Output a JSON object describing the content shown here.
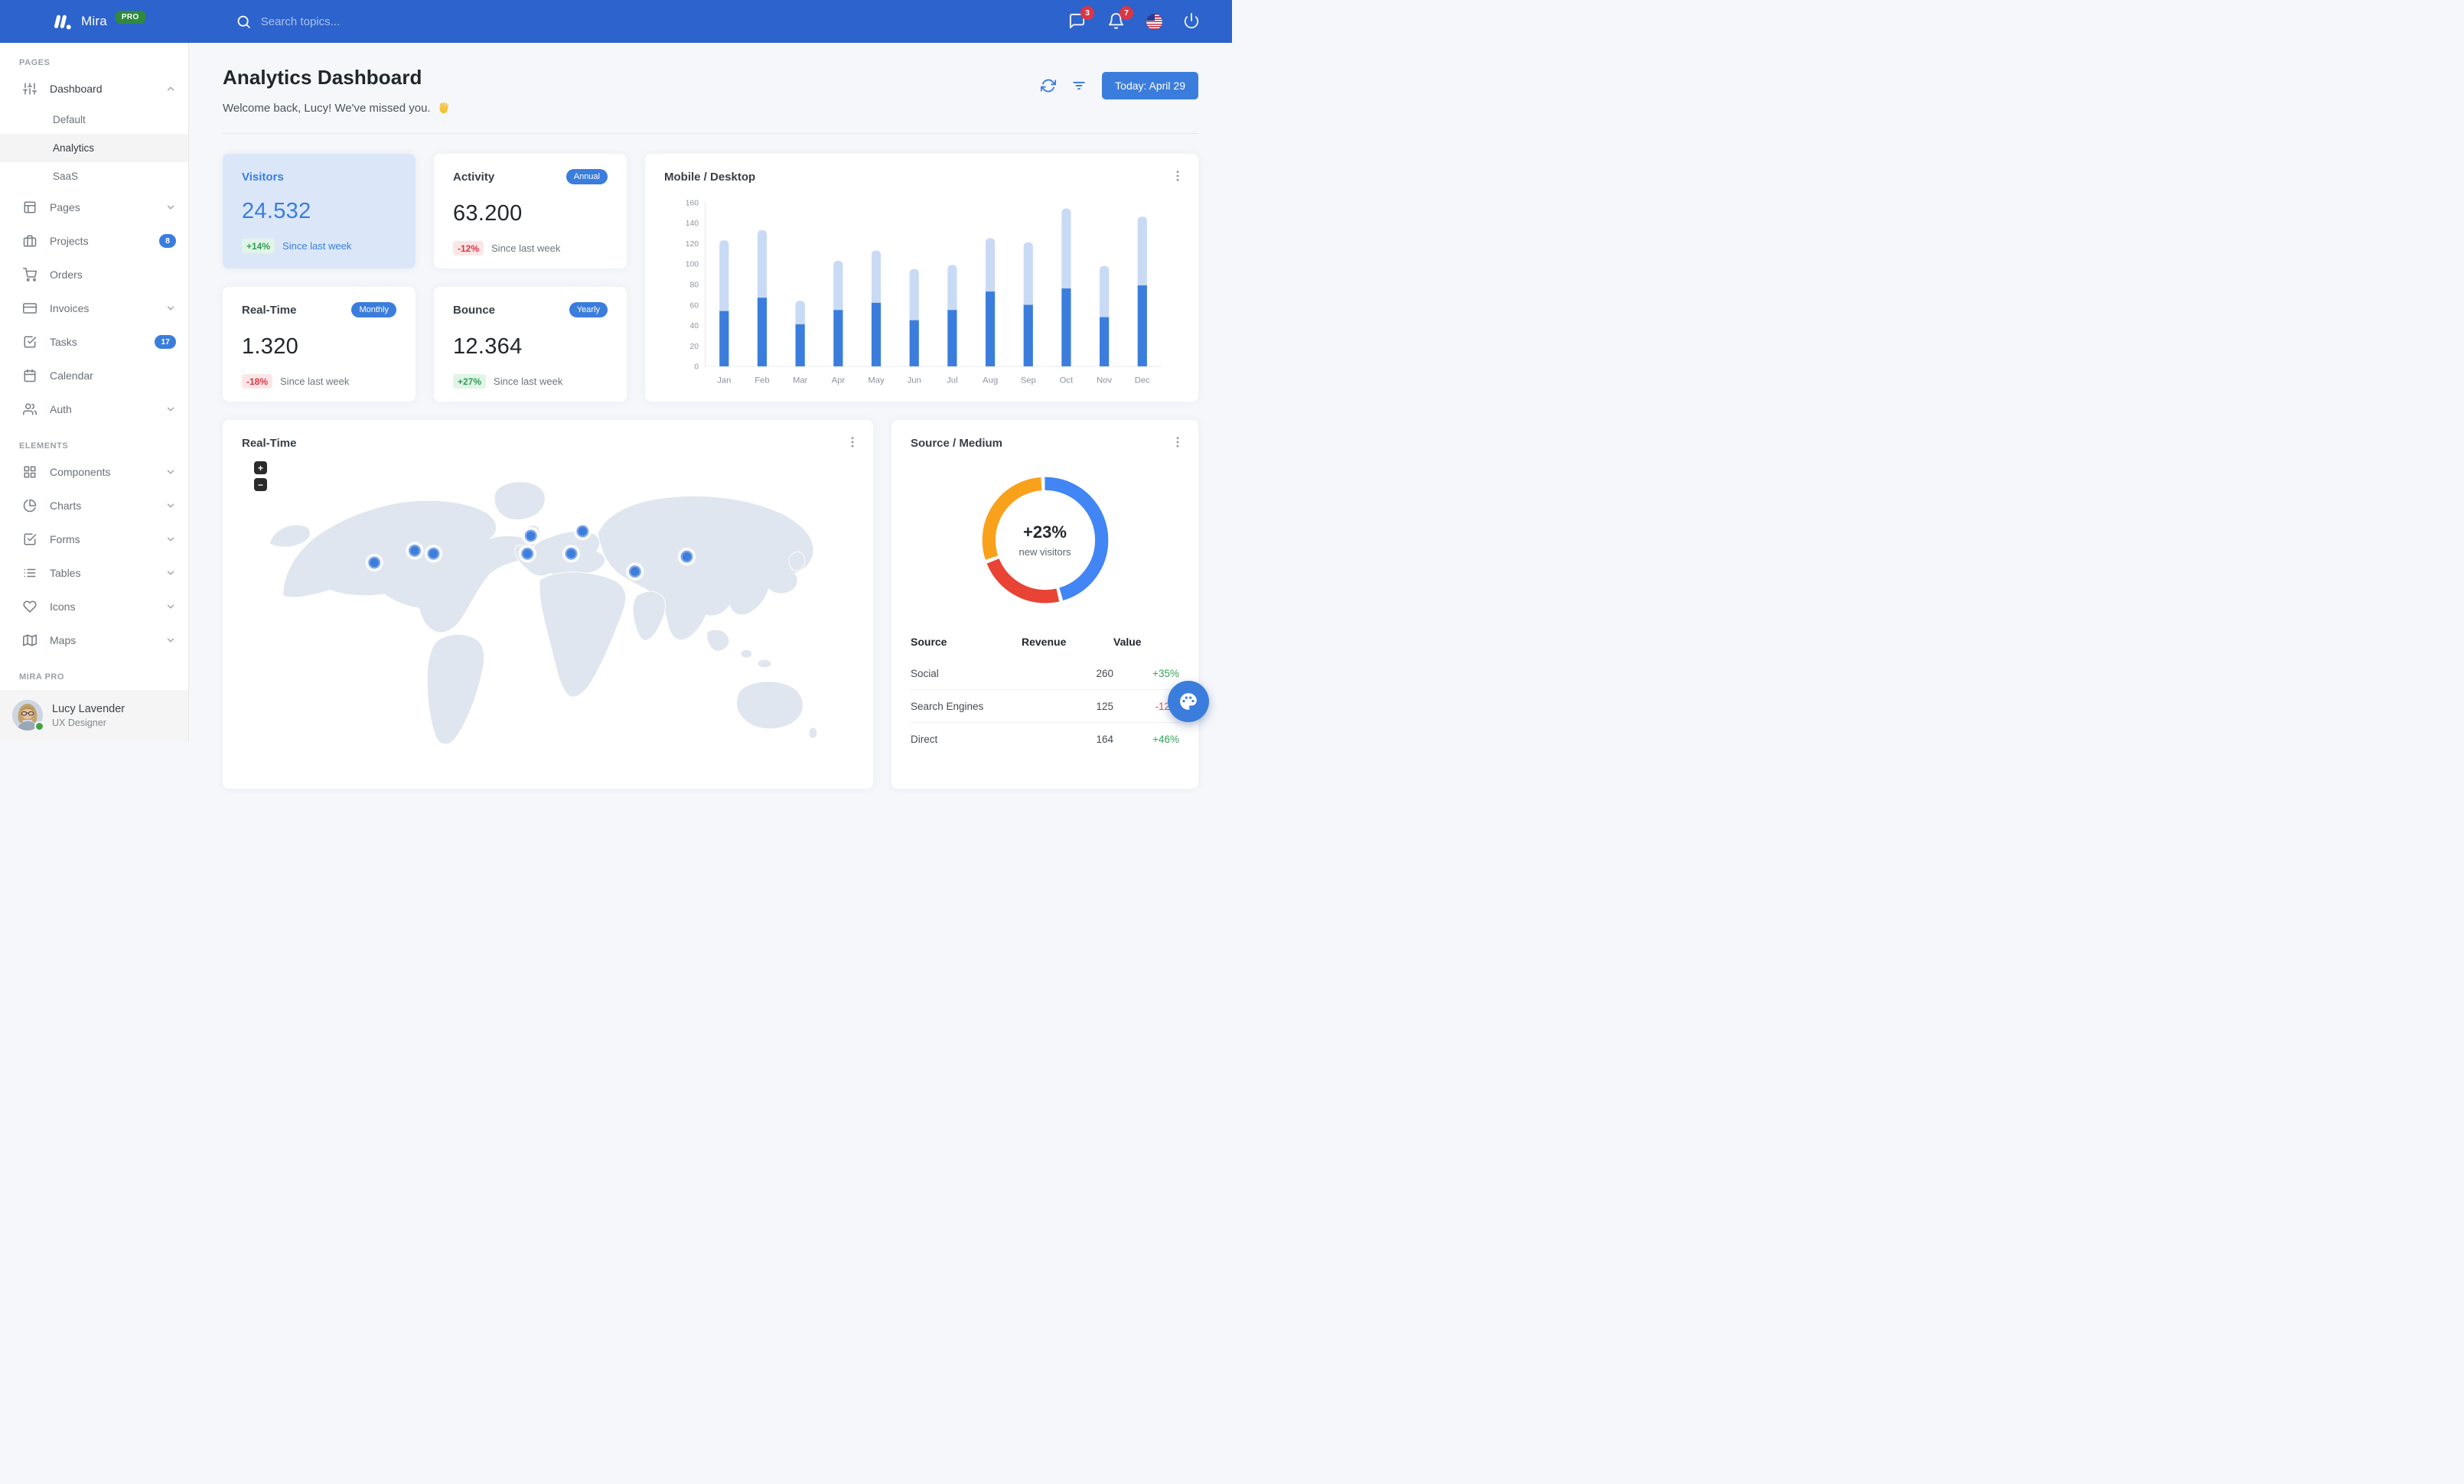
{
  "navbar": {
    "brand": "Mira",
    "brand_badge": "PRO",
    "search_placeholder": "Search topics...",
    "messages_badge": "3",
    "notifications_badge": "7"
  },
  "sidebar": {
    "sections": {
      "pages_label": "Pages",
      "elements_label": "Elements",
      "pro_label": "Mira Pro"
    },
    "items": {
      "dashboard": {
        "label": "Dashboard"
      },
      "default": {
        "label": "Default"
      },
      "analytics": {
        "label": "Analytics"
      },
      "saas": {
        "label": "SaaS"
      },
      "pages": {
        "label": "Pages"
      },
      "projects": {
        "label": "Projects",
        "badge": "8"
      },
      "orders": {
        "label": "Orders"
      },
      "invoices": {
        "label": "Invoices"
      },
      "tasks": {
        "label": "Tasks",
        "badge": "17"
      },
      "calendar": {
        "label": "Calendar"
      },
      "auth": {
        "label": "Auth"
      },
      "components": {
        "label": "Components"
      },
      "charts": {
        "label": "Charts"
      },
      "forms": {
        "label": "Forms"
      },
      "tables": {
        "label": "Tables"
      },
      "icons": {
        "label": "Icons"
      },
      "maps": {
        "label": "Maps"
      }
    },
    "user": {
      "name": "Lucy Lavender",
      "role": "UX Designer"
    }
  },
  "header": {
    "title": "Analytics Dashboard",
    "subtitle": "Welcome back, Lucy! We've missed you.",
    "date_button": "Today: April 29"
  },
  "stats": [
    {
      "title": "Visitors",
      "badge": "",
      "value": "24.532",
      "delta": "+14%",
      "caption": "Since last week"
    },
    {
      "title": "Activity",
      "badge": "Annual",
      "value": "63.200",
      "delta": "-12%",
      "caption": "Since last week"
    },
    {
      "title": "Real-Time",
      "badge": "Monthly",
      "value": "1.320",
      "delta": "-18%",
      "caption": "Since last week"
    },
    {
      "title": "Bounce",
      "badge": "Yearly",
      "value": "12.364",
      "delta": "+27%",
      "caption": "Since last week"
    }
  ],
  "panels": {
    "bar_title": "Mobile / Desktop",
    "map_title": "Real-Time",
    "donut_title": "Source / Medium"
  },
  "map": {
    "zoom_in": "+",
    "zoom_out": "−",
    "markers": [
      {
        "x": 19.5,
        "y": 35.0
      },
      {
        "x": 26.6,
        "y": 31.0
      },
      {
        "x": 29.9,
        "y": 32.0
      },
      {
        "x": 46.4,
        "y": 32.0
      },
      {
        "x": 47.0,
        "y": 26.0
      },
      {
        "x": 54.1,
        "y": 32.0
      },
      {
        "x": 56.1,
        "y": 24.5
      },
      {
        "x": 65.3,
        "y": 38.0
      },
      {
        "x": 74.4,
        "y": 33.0
      }
    ]
  },
  "source_table": {
    "columns": [
      "Source",
      "Revenue",
      "Value"
    ],
    "rows": [
      {
        "source": "Social",
        "revenue": "260",
        "value": "+35%"
      },
      {
        "source": "Search Engines",
        "revenue": "125",
        "value": "-12%"
      },
      {
        "source": "Direct",
        "revenue": "164",
        "value": "+46%"
      }
    ]
  },
  "chart_data": [
    {
      "type": "bar",
      "stacked": true,
      "title": "Mobile / Desktop",
      "categories": [
        "Jan",
        "Feb",
        "Mar",
        "Apr",
        "May",
        "Jun",
        "Jul",
        "Aug",
        "Sep",
        "Oct",
        "Nov",
        "Dec"
      ],
      "series": [
        {
          "name": "Mobile",
          "color": "#3B7DDD",
          "values": [
            54,
            67,
            41,
            55,
            62,
            45,
            55,
            73,
            60,
            76,
            48,
            79
          ]
        },
        {
          "name": "Desktop",
          "color": "#C9DAF5",
          "values": [
            69,
            66,
            23,
            48,
            51,
            50,
            44,
            52,
            61,
            78,
            50,
            67
          ]
        }
      ],
      "ylim": [
        0,
        160
      ],
      "yticks": [
        0,
        20,
        40,
        60,
        80,
        100,
        120,
        140,
        160
      ],
      "grid": false,
      "legend": "none"
    },
    {
      "type": "donut",
      "title": "Source / Medium",
      "center_title": "+23%",
      "center_subtitle": "new visitors",
      "gap": 1,
      "slices": [
        {
          "name": "blue",
          "value": 45.5,
          "color": "#4285F4"
        },
        {
          "name": "red",
          "value": 22.5,
          "color": "#E94335"
        },
        {
          "name": "orange",
          "value": 29.0,
          "color": "#F9A11B"
        }
      ]
    }
  ]
}
